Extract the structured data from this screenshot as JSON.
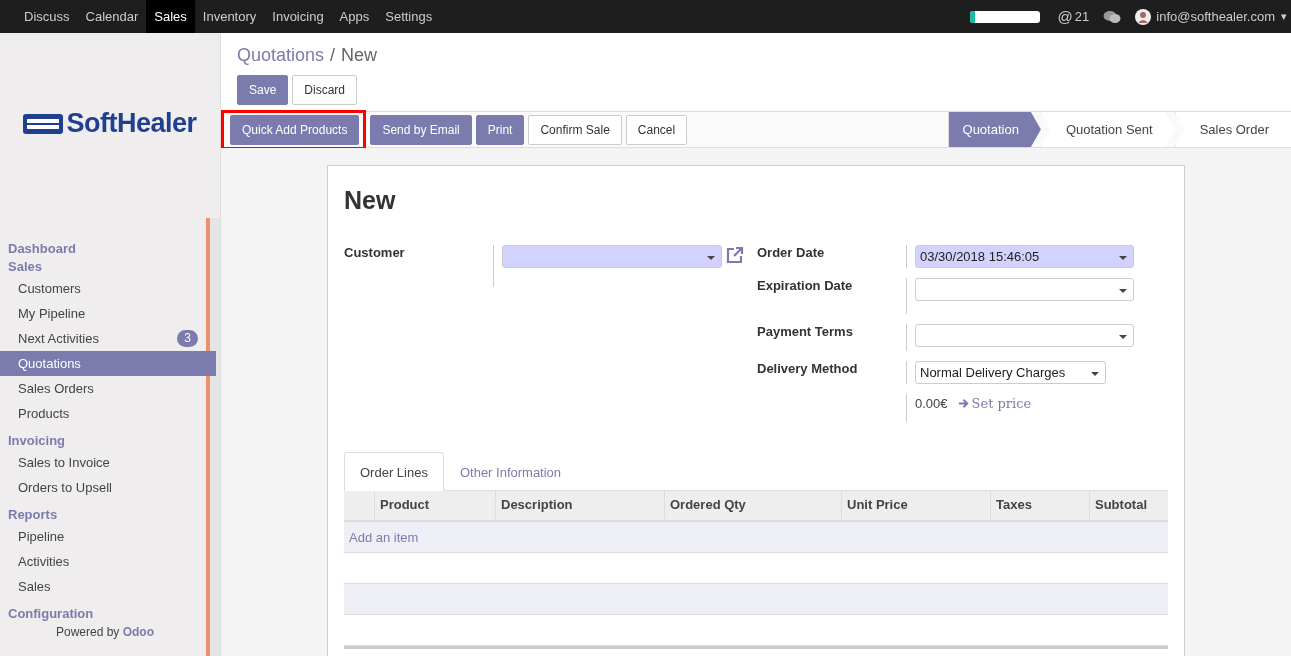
{
  "top_menu": [
    {
      "label": "Discuss",
      "selected": false
    },
    {
      "label": "Calendar",
      "selected": false
    },
    {
      "label": "Sales",
      "selected": true
    },
    {
      "label": "Inventory",
      "selected": false
    },
    {
      "label": "Invoicing",
      "selected": false
    },
    {
      "label": "Apps",
      "selected": false
    },
    {
      "label": "Settings",
      "selected": false
    }
  ],
  "systray": {
    "progress": {
      "level": 0.08
    },
    "mention_symbol": "@",
    "mentions": "21",
    "user": "info@softhealer.com",
    "user_caret": "▾"
  },
  "logo": {
    "text": "SoftHealer"
  },
  "sidebar": [
    {
      "heading": "Dashboard"
    },
    {
      "heading": "Sales",
      "items": [
        {
          "label": "Customers",
          "selected": false
        },
        {
          "label": "My Pipeline",
          "selected": false
        },
        {
          "label": "Next Activities",
          "selected": false,
          "badge": "3"
        },
        {
          "label": "Quotations",
          "selected": true
        },
        {
          "label": "Sales Orders",
          "selected": false
        },
        {
          "label": "Products",
          "selected": false
        }
      ]
    },
    {
      "heading": "Invoicing",
      "items": [
        {
          "label": "Sales to Invoice",
          "selected": false
        },
        {
          "label": "Orders to Upsell",
          "selected": false
        }
      ]
    },
    {
      "heading": "Reports",
      "items": [
        {
          "label": "Pipeline",
          "selected": false
        },
        {
          "label": "Activities",
          "selected": false
        },
        {
          "label": "Sales",
          "selected": false
        }
      ]
    },
    {
      "heading": "Configuration"
    }
  ],
  "powered_by": {
    "text": "Powered by",
    "brand": "Odoo"
  },
  "breadcrumb": {
    "parent": "Quotations",
    "separator": "/",
    "current": "New"
  },
  "edit_buttons": [
    {
      "label": "Save",
      "kind": "primary"
    },
    {
      "label": "Discard",
      "kind": "default"
    }
  ],
  "action_buttons": [
    {
      "label": "Quick Add Products",
      "kind": "primary",
      "highlighted": true
    },
    {
      "label": "Send by Email",
      "kind": "primary",
      "highlighted": false
    },
    {
      "label": "Print",
      "kind": "primary",
      "highlighted": false
    },
    {
      "label": "Confirm Sale",
      "kind": "default",
      "highlighted": false
    },
    {
      "label": "Cancel",
      "kind": "default",
      "highlighted": false
    }
  ],
  "status_steps": [
    {
      "label": "Quotation",
      "selected": true
    },
    {
      "label": "Quotation Sent",
      "selected": false
    },
    {
      "label": "Sales Order",
      "selected": false
    }
  ],
  "form": {
    "title": "New",
    "customer": {
      "label": "Customer",
      "required": true
    },
    "right_fields": [
      {
        "label": "Order Date",
        "value": "03/30/2018 15:46:05",
        "required": true
      },
      {
        "label": "Expiration Date",
        "required": false
      },
      {
        "label": "Payment Terms",
        "required": false
      }
    ],
    "delivery": {
      "label": "Delivery Method",
      "value": "Normal Delivery Charges",
      "price": "0.00€",
      "link": "Set price"
    },
    "tabs": [
      {
        "label": "Order Lines",
        "selected": true
      },
      {
        "label": "Other Information",
        "selected": false
      }
    ],
    "columns": [
      "Product",
      "Description",
      "Ordered Qty",
      "Unit Price",
      "Taxes",
      "Subtotal"
    ],
    "add_item": "Add an item"
  }
}
